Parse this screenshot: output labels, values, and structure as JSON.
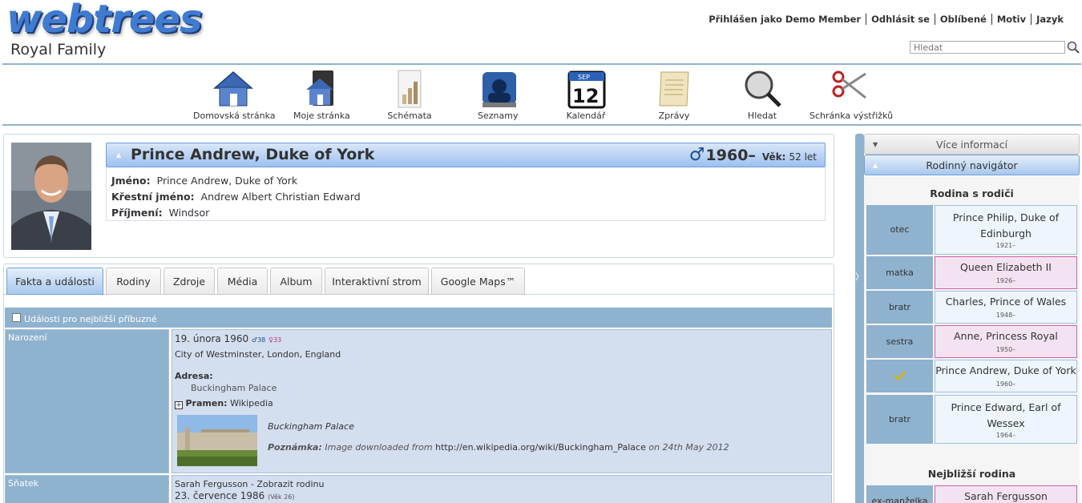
{
  "header": {
    "logo": "webtrees",
    "site_title": "Royal Family",
    "topmenu": [
      "Přihlášen jako Demo Member",
      "Odhlásit se",
      "Oblíbené",
      "Motiv",
      "Jazyk"
    ],
    "search_placeholder": "Hledat"
  },
  "mainmenu": [
    {
      "label": "Domovská stránka",
      "icon": "home-icon"
    },
    {
      "label": "Moje stránka",
      "icon": "my-page-icon"
    },
    {
      "label": "Schémata",
      "icon": "charts-icon"
    },
    {
      "label": "Seznamy",
      "icon": "lists-icon"
    },
    {
      "label": "Kalendář",
      "icon": "calendar-icon"
    },
    {
      "label": "Zprávy",
      "icon": "reports-icon"
    },
    {
      "label": "Hledat",
      "icon": "search-icon"
    },
    {
      "label": "Schránka výstřižků",
      "icon": "clippings-icon"
    }
  ],
  "calendar_icon": {
    "month": "SEP",
    "day": "12"
  },
  "person": {
    "name": "Prince Andrew, Duke of York",
    "sex_symbol": "♂",
    "years": "1960–",
    "age_label": "Věk:",
    "age_value": "52 let",
    "details": [
      {
        "label": "Jméno:",
        "value": "Prince Andrew, Duke of York"
      },
      {
        "label": "Křestní jméno:",
        "value": "Andrew Albert Christian Edward"
      },
      {
        "label": "Příjmení:",
        "value": "Windsor"
      }
    ]
  },
  "tabs": [
    "Fakta a události",
    "Rodiny",
    "Zdroje",
    "Média",
    "Album",
    "Interaktivní strom",
    "Google Maps™"
  ],
  "active_tab": 0,
  "events": {
    "toggle_label": "Události pro nejbližší příbuzné",
    "birth": {
      "label": "Narození",
      "date": "19. února 1960",
      "father_age": "♂38",
      "mother_age": "♀33",
      "place": "City of Westminster, London, England",
      "address_label": "Adresa:",
      "address": "Buckingham Palace",
      "source_label": "Pramen:",
      "source": "Wikipedia",
      "media_title": "Buckingham Palace",
      "note_label": "Poznámka:",
      "note_text_1": "Image downloaded from",
      "note_link": "http://en.wikipedia.org/wiki/Buckingham_Palace",
      "note_text_2": "on 24th May 2012"
    },
    "marriage": {
      "label": "Sňatek",
      "spouse": "Sarah Fergusson - Zobrazit rodinu",
      "date": "23. července 1986",
      "age": "(Věk 26)"
    }
  },
  "sidebar": {
    "more_info": "Více informací",
    "family_nav": "Rodinný navigátor",
    "parents_family_title": "Rodina s rodiči",
    "parents_family": [
      {
        "relation": "otec",
        "name": "Prince Philip, Duke of Edinburgh",
        "years": "1921–",
        "sex": "m"
      },
      {
        "relation": "matka",
        "name": "Queen Elizabeth II",
        "years": "1926–",
        "sex": "f"
      },
      {
        "relation": "bratr",
        "name": "Charles, Prince of Wales",
        "years": "1948–",
        "sex": "m"
      },
      {
        "relation": "sestra",
        "name": "Anne, Princess Royal",
        "years": "1950–",
        "sex": "f"
      },
      {
        "relation": "",
        "name": "Prince Andrew, Duke of York",
        "years": "1960–",
        "sex": "m"
      },
      {
        "relation": "bratr",
        "name": "Prince Edward, Earl of Wessex",
        "years": "1964–",
        "sex": "m"
      }
    ],
    "immediate_family_title": "Nejbližší rodina",
    "immediate_family": [
      {
        "relation": "ex-manželka",
        "name": "Sarah Fergusson",
        "sex": "f"
      }
    ]
  },
  "colors": {
    "accent": "#8fb2cf",
    "male_box": "#eef5fc",
    "female_box": "#f3e3f2",
    "female_border": "#d75da8",
    "fact_value_bg": "#d3deef"
  }
}
